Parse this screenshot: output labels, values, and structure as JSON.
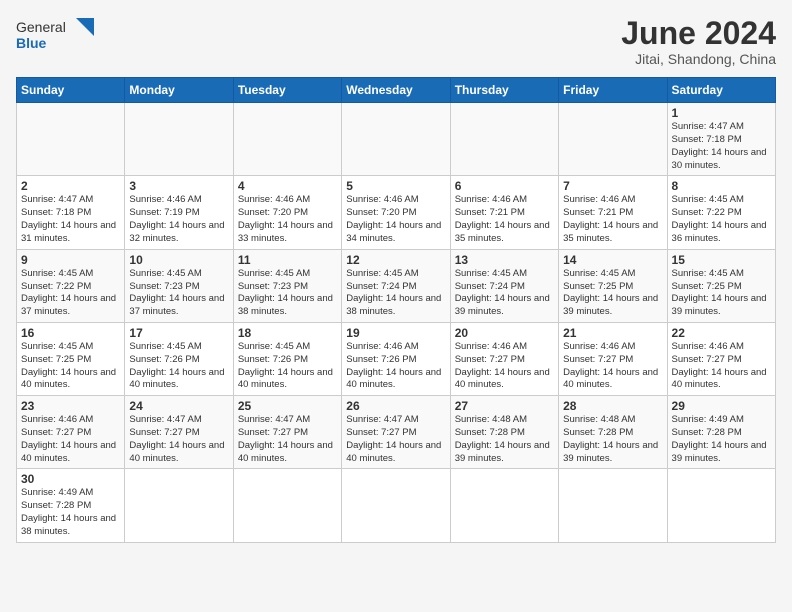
{
  "header": {
    "logo_general": "General",
    "logo_blue": "Blue",
    "month_title": "June 2024",
    "subtitle": "Jitai, Shandong, China"
  },
  "days_of_week": [
    "Sunday",
    "Monday",
    "Tuesday",
    "Wednesday",
    "Thursday",
    "Friday",
    "Saturday"
  ],
  "weeks": [
    [
      {
        "day": "",
        "info": ""
      },
      {
        "day": "",
        "info": ""
      },
      {
        "day": "",
        "info": ""
      },
      {
        "day": "",
        "info": ""
      },
      {
        "day": "",
        "info": ""
      },
      {
        "day": "",
        "info": ""
      },
      {
        "day": "1",
        "info": "Sunrise: 4:47 AM\nSunset: 7:18 PM\nDaylight: 14 hours and 30 minutes."
      }
    ],
    [
      {
        "day": "2",
        "info": "Sunrise: 4:47 AM\nSunset: 7:18 PM\nDaylight: 14 hours and 31 minutes."
      },
      {
        "day": "3",
        "info": "Sunrise: 4:46 AM\nSunset: 7:19 PM\nDaylight: 14 hours and 32 minutes."
      },
      {
        "day": "4",
        "info": "Sunrise: 4:46 AM\nSunset: 7:20 PM\nDaylight: 14 hours and 33 minutes."
      },
      {
        "day": "5",
        "info": "Sunrise: 4:46 AM\nSunset: 7:20 PM\nDaylight: 14 hours and 34 minutes."
      },
      {
        "day": "6",
        "info": "Sunrise: 4:46 AM\nSunset: 7:21 PM\nDaylight: 14 hours and 35 minutes."
      },
      {
        "day": "7",
        "info": "Sunrise: 4:46 AM\nSunset: 7:21 PM\nDaylight: 14 hours and 35 minutes."
      },
      {
        "day": "8",
        "info": "Sunrise: 4:45 AM\nSunset: 7:22 PM\nDaylight: 14 hours and 36 minutes."
      }
    ],
    [
      {
        "day": "9",
        "info": "Sunrise: 4:45 AM\nSunset: 7:22 PM\nDaylight: 14 hours and 37 minutes."
      },
      {
        "day": "10",
        "info": "Sunrise: 4:45 AM\nSunset: 7:23 PM\nDaylight: 14 hours and 37 minutes."
      },
      {
        "day": "11",
        "info": "Sunrise: 4:45 AM\nSunset: 7:23 PM\nDaylight: 14 hours and 38 minutes."
      },
      {
        "day": "12",
        "info": "Sunrise: 4:45 AM\nSunset: 7:24 PM\nDaylight: 14 hours and 38 minutes."
      },
      {
        "day": "13",
        "info": "Sunrise: 4:45 AM\nSunset: 7:24 PM\nDaylight: 14 hours and 39 minutes."
      },
      {
        "day": "14",
        "info": "Sunrise: 4:45 AM\nSunset: 7:25 PM\nDaylight: 14 hours and 39 minutes."
      },
      {
        "day": "15",
        "info": "Sunrise: 4:45 AM\nSunset: 7:25 PM\nDaylight: 14 hours and 39 minutes."
      }
    ],
    [
      {
        "day": "16",
        "info": "Sunrise: 4:45 AM\nSunset: 7:25 PM\nDaylight: 14 hours and 40 minutes."
      },
      {
        "day": "17",
        "info": "Sunrise: 4:45 AM\nSunset: 7:26 PM\nDaylight: 14 hours and 40 minutes."
      },
      {
        "day": "18",
        "info": "Sunrise: 4:45 AM\nSunset: 7:26 PM\nDaylight: 14 hours and 40 minutes."
      },
      {
        "day": "19",
        "info": "Sunrise: 4:46 AM\nSunset: 7:26 PM\nDaylight: 14 hours and 40 minutes."
      },
      {
        "day": "20",
        "info": "Sunrise: 4:46 AM\nSunset: 7:27 PM\nDaylight: 14 hours and 40 minutes."
      },
      {
        "day": "21",
        "info": "Sunrise: 4:46 AM\nSunset: 7:27 PM\nDaylight: 14 hours and 40 minutes."
      },
      {
        "day": "22",
        "info": "Sunrise: 4:46 AM\nSunset: 7:27 PM\nDaylight: 14 hours and 40 minutes."
      }
    ],
    [
      {
        "day": "23",
        "info": "Sunrise: 4:46 AM\nSunset: 7:27 PM\nDaylight: 14 hours and 40 minutes."
      },
      {
        "day": "24",
        "info": "Sunrise: 4:47 AM\nSunset: 7:27 PM\nDaylight: 14 hours and 40 minutes."
      },
      {
        "day": "25",
        "info": "Sunrise: 4:47 AM\nSunset: 7:27 PM\nDaylight: 14 hours and 40 minutes."
      },
      {
        "day": "26",
        "info": "Sunrise: 4:47 AM\nSunset: 7:27 PM\nDaylight: 14 hours and 40 minutes."
      },
      {
        "day": "27",
        "info": "Sunrise: 4:48 AM\nSunset: 7:28 PM\nDaylight: 14 hours and 39 minutes."
      },
      {
        "day": "28",
        "info": "Sunrise: 4:48 AM\nSunset: 7:28 PM\nDaylight: 14 hours and 39 minutes."
      },
      {
        "day": "29",
        "info": "Sunrise: 4:49 AM\nSunset: 7:28 PM\nDaylight: 14 hours and 39 minutes."
      }
    ],
    [
      {
        "day": "30",
        "info": "Sunrise: 4:49 AM\nSunset: 7:28 PM\nDaylight: 14 hours and 38 minutes."
      },
      {
        "day": "",
        "info": ""
      },
      {
        "day": "",
        "info": ""
      },
      {
        "day": "",
        "info": ""
      },
      {
        "day": "",
        "info": ""
      },
      {
        "day": "",
        "info": ""
      },
      {
        "day": "",
        "info": ""
      }
    ]
  ]
}
